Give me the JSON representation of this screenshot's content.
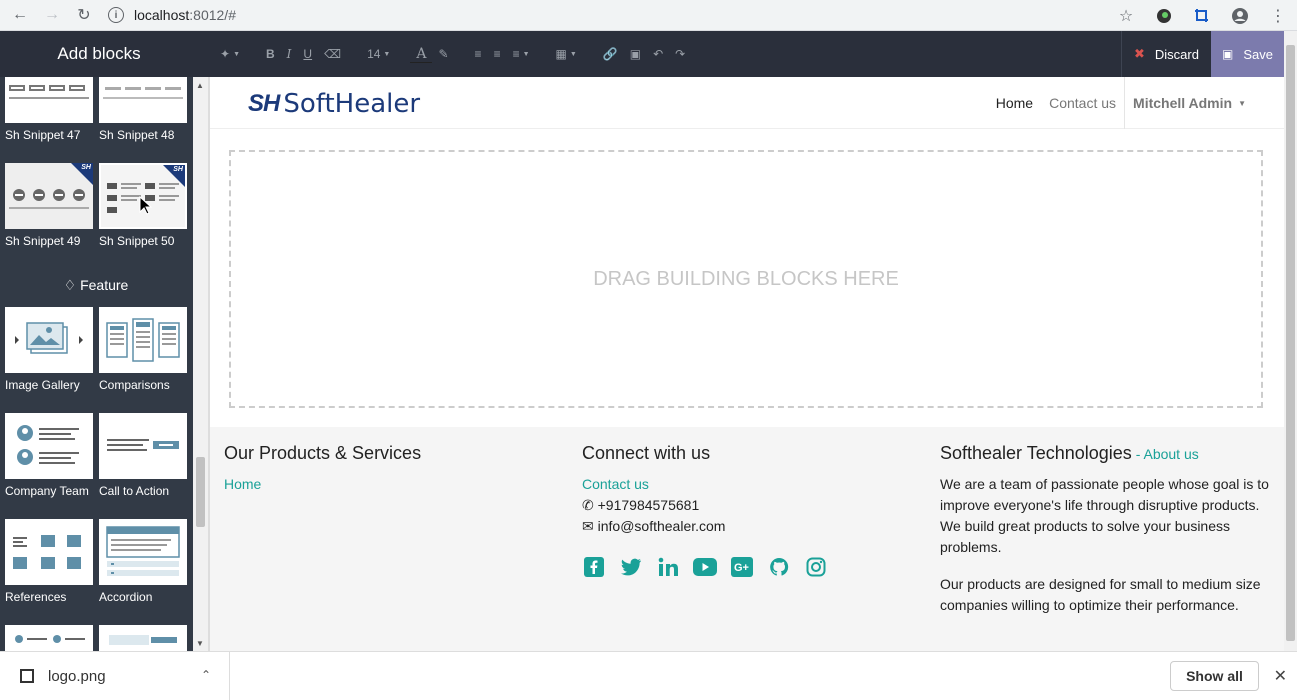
{
  "browser": {
    "url_host": "localhost",
    "url_rest": ":8012/#"
  },
  "sidebar": {
    "title": "Add blocks",
    "snippets_top": [
      "Sh Snippet 47",
      "Sh Snippet 48",
      "Sh Snippet 49",
      "Sh Snippet 50"
    ],
    "category": "Feature",
    "features": [
      "Image Gallery",
      "Comparisons",
      "Company Team",
      "Call to Action",
      "References",
      "Accordion"
    ]
  },
  "toolbar": {
    "font_size": "14",
    "discard": "Discard",
    "save": "Save"
  },
  "site": {
    "logo_mark": "SH",
    "logo_text": "SoftHealer",
    "menu": {
      "home": "Home",
      "contact": "Contact us",
      "user": "Mitchell Admin"
    },
    "dropzone": "DRAG BUILDING BLOCKS HERE",
    "footer": {
      "col1": {
        "title": "Our Products & Services",
        "link": "Home"
      },
      "col2": {
        "title": "Connect with us",
        "contact": "Contact us",
        "phone": "+917984575681",
        "email": "info@softhealer.com"
      },
      "col3": {
        "title": "Softhealer Technologies",
        "sep": " - ",
        "about": "About us",
        "p1": "We are a team of passionate people whose goal is to improve everyone's life through disruptive products. We build great products to solve your business problems.",
        "p2": "Our products are designed for small to medium size companies willing to optimize their performance."
      }
    }
  },
  "downloads": {
    "file": "logo.png",
    "show_all": "Show all"
  },
  "colors": {
    "accent": "#1aa198",
    "brand": "#1c3a7a",
    "save": "#7c7bad"
  }
}
